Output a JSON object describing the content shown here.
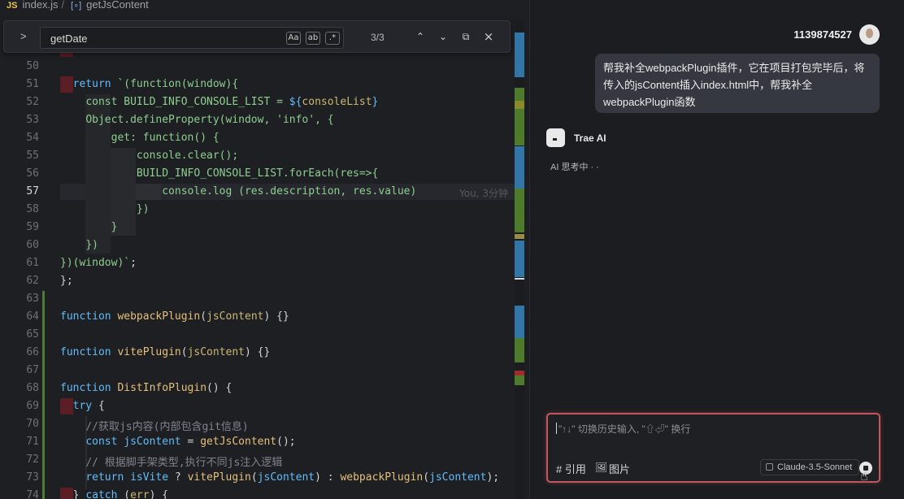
{
  "breadcrumb": {
    "file_icon": "JS",
    "file": "index.js",
    "separator": "/",
    "symbol_icon": "[∘]",
    "symbol": "getJsContent"
  },
  "find": {
    "expand_icon": ">",
    "query": "getDate",
    "match_case_icon": "Aa",
    "whole_word_icon": "ab",
    "regex_icon": ".*",
    "count": "3/3",
    "prev_icon": "⌃",
    "next_icon": "⌄",
    "selection_icon": "⧉",
    "close_icon": "×"
  },
  "editor": {
    "line_numbers": [
      "50",
      "51",
      "52",
      "53",
      "54",
      "55",
      "56",
      "57",
      "58",
      "59",
      "60",
      "61",
      "62",
      "63",
      "64",
      "65",
      "66",
      "67",
      "68",
      "69",
      "70",
      "71",
      "72",
      "73",
      "74"
    ],
    "active_line": "57",
    "blame": "You, 3分钟"
  },
  "chat": {
    "user_name": "1139874527",
    "user_message": "帮我补全webpackPlugin插件，它在项目打包完毕后，将传入的jsContent插入index.html中，帮我补全webpackPlugin函数",
    "ai_name": "Trae AI",
    "ai_status": "AI 思考中 · ·",
    "input_placeholder": "\"↑↓\" 切换历史输入, \"⇧⏎\" 换行",
    "reference_label": "# 引用",
    "image_label": "图片",
    "model": "Claude-3.5-Sonnet"
  },
  "colors": {
    "input_border": "#c4565f",
    "bubble": "#353840",
    "keyword": "#61bdfc",
    "function": "#e6c07b",
    "string": "#8dcf90"
  }
}
